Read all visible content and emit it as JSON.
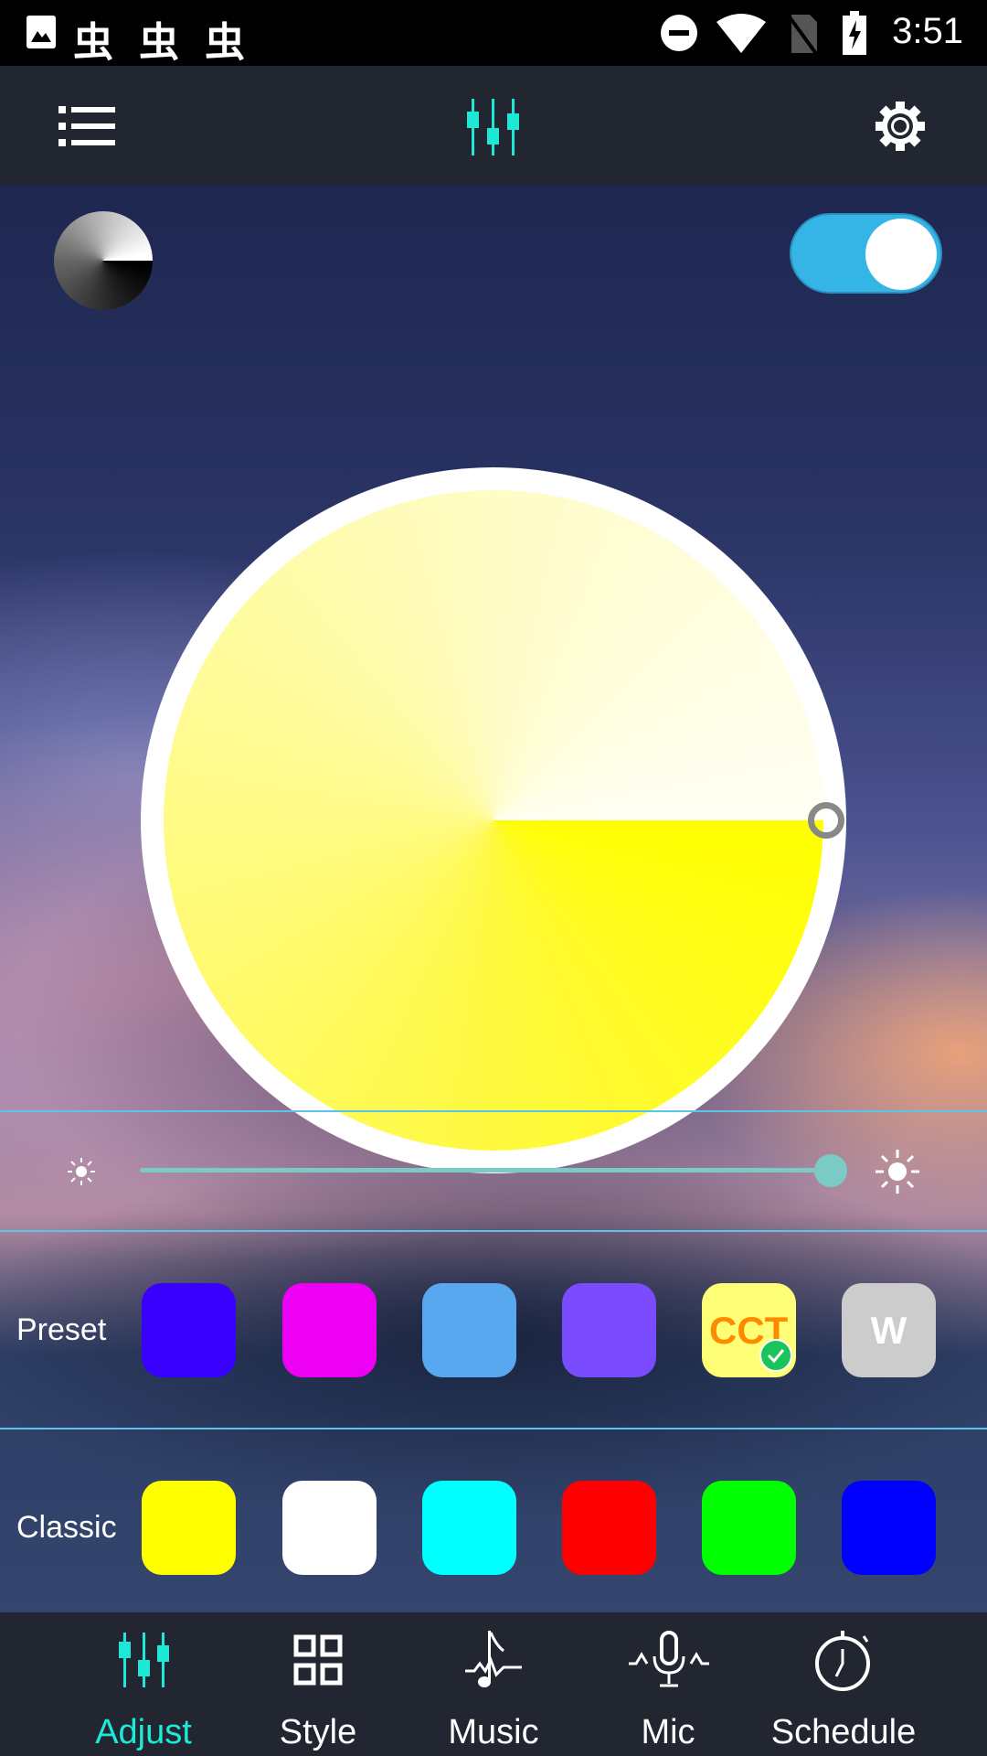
{
  "status_bar": {
    "time": "3:51",
    "notification_glyph": "虫",
    "icons": [
      "image-icon",
      "bug-icon",
      "bug-icon",
      "bug-icon",
      "dnd-icon",
      "wifi-icon",
      "no-sim-icon",
      "battery-charging-icon"
    ]
  },
  "toolbar": {
    "left_icon": "list-menu-icon",
    "center_icon": "equalizer-sliders-icon",
    "right_icon": "gear-icon",
    "accent": "#1de9d6"
  },
  "controls": {
    "power_on": true,
    "toggle_color": "#35b5e5"
  },
  "color_wheel": {
    "selected_color": "#ffff00"
  },
  "brightness": {
    "value_percent": 100
  },
  "preset": {
    "label": "Preset",
    "swatches": [
      {
        "color": "#3a00ff",
        "text": ""
      },
      {
        "color": "#ee00f5",
        "text": ""
      },
      {
        "color": "#58a8f0",
        "text": ""
      },
      {
        "color": "#7b4cff",
        "text": ""
      },
      {
        "color": "#ffff77",
        "text": "CCT",
        "selected": true
      },
      {
        "color": "#cccccc",
        "text": "W"
      }
    ]
  },
  "classic": {
    "label": "Classic",
    "swatches": [
      "#ffff00",
      "#ffffff",
      "#00ffff",
      "#ff0000",
      "#00ff00",
      "#0000ff"
    ]
  },
  "nav": {
    "items": [
      {
        "label": "Adjust",
        "icon": "sliders-icon",
        "active": true
      },
      {
        "label": "Style",
        "icon": "grid-icon"
      },
      {
        "label": "Music",
        "icon": "music-note-icon"
      },
      {
        "label": "Mic",
        "icon": "microphone-icon"
      },
      {
        "label": "Schedule",
        "icon": "stopwatch-icon"
      }
    ],
    "active_color": "#1de9d6"
  }
}
